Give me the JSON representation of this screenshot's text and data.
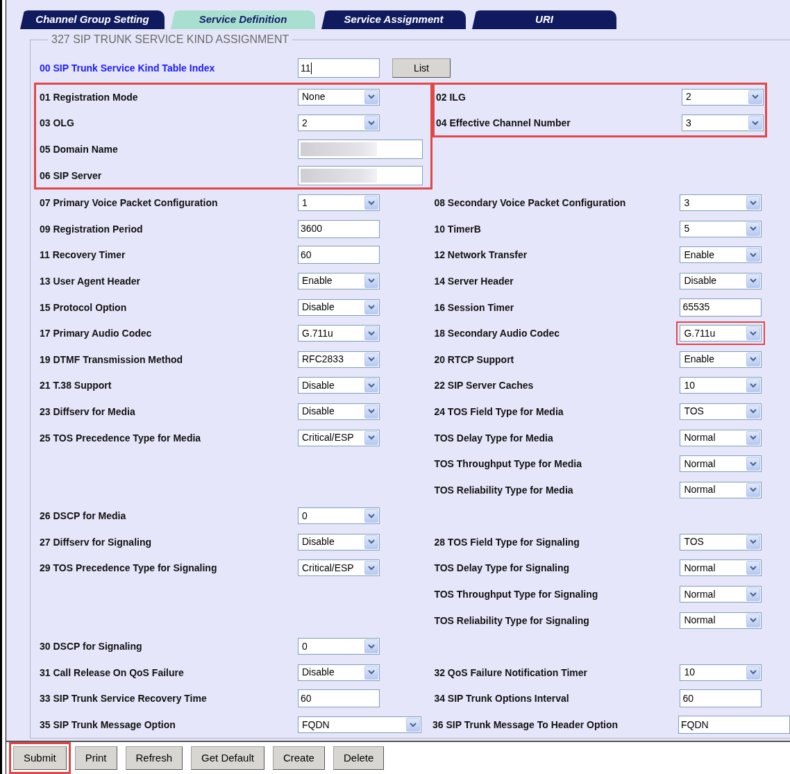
{
  "tabs": [
    {
      "label": "Channel Group Setting",
      "selected": false
    },
    {
      "label": "Service Definition",
      "selected": true
    },
    {
      "label": "Service Assignment",
      "selected": false
    },
    {
      "label": "URI",
      "selected": false
    }
  ],
  "legend": "327 SIP TRUNK SERVICE KIND ASSIGNMENT",
  "index_field": {
    "label": "00 SIP Trunk Service Kind Table Index",
    "value": "11",
    "focused": true,
    "button": "List"
  },
  "top_block": {
    "left": {
      "highlighted": true,
      "fields": [
        {
          "label": "01 Registration Mode",
          "kind": "select",
          "value": "None"
        },
        {
          "label": "03 OLG",
          "kind": "select",
          "value": "2"
        },
        {
          "label": "05 Domain Name",
          "kind": "blurred"
        },
        {
          "label": "06 SIP Server",
          "kind": "blurred"
        }
      ]
    },
    "right": {
      "highlighted": true,
      "fields": [
        {
          "label": "02 ILG",
          "kind": "select",
          "value": "2"
        },
        {
          "label": "04 Effective Channel Number",
          "kind": "select",
          "value": "3"
        }
      ]
    }
  },
  "rows": [
    {
      "left": {
        "label": "07 Primary Voice Packet Configuration",
        "kind": "select",
        "value": "1"
      },
      "right": {
        "label": "08 Secondary Voice Packet Configuration",
        "kind": "select",
        "value": "3"
      }
    },
    {
      "left": {
        "label": "09 Registration Period",
        "kind": "text",
        "value": "3600"
      },
      "right": {
        "label": "10 TimerB",
        "kind": "select",
        "value": "5"
      }
    },
    {
      "left": {
        "label": "11 Recovery Timer",
        "kind": "text",
        "value": "60"
      },
      "right": {
        "label": "12 Network Transfer",
        "kind": "select",
        "value": "Enable"
      }
    },
    {
      "left": {
        "label": "13 User Agent Header",
        "kind": "select",
        "value": "Enable"
      },
      "right": {
        "label": "14 Server Header",
        "kind": "select",
        "value": "Disable"
      }
    },
    {
      "left": {
        "label": "15 Protocol Option",
        "kind": "select",
        "value": "Disable"
      },
      "right": {
        "label": "16 Session Timer",
        "kind": "text",
        "value": "65535"
      }
    },
    {
      "left": {
        "label": "17 Primary Audio Codec",
        "kind": "select",
        "value": "G.711u"
      },
      "right": {
        "label": "18 Secondary Audio Codec",
        "kind": "select",
        "value": "G.711u",
        "highlighted": true
      }
    },
    {
      "left": {
        "label": "19 DTMF Transmission Method",
        "kind": "select",
        "value": "RFC2833"
      },
      "right": {
        "label": "20 RTCP Support",
        "kind": "select",
        "value": "Enable"
      }
    },
    {
      "left": {
        "label": "21 T.38 Support",
        "kind": "select",
        "value": "Disable"
      },
      "right": {
        "label": "22 SIP Server Caches",
        "kind": "select",
        "value": "10"
      }
    },
    {
      "left": {
        "label": "23 Diffserv for Media",
        "kind": "select",
        "value": "Disable"
      },
      "right": {
        "label": "24 TOS Field Type for Media",
        "kind": "select",
        "value": "TOS"
      }
    },
    {
      "left": {
        "label": "25 TOS Precedence Type for Media",
        "kind": "select",
        "value": "Critical/ESP"
      },
      "right": {
        "label": "TOS Delay Type for Media",
        "kind": "select",
        "value": "Normal"
      }
    },
    {
      "right": {
        "label": "TOS Throughput Type for Media",
        "kind": "select",
        "value": "Normal"
      }
    },
    {
      "right": {
        "label": "TOS Reliability Type for Media",
        "kind": "select",
        "value": "Normal"
      }
    },
    {
      "left": {
        "label": "26 DSCP for Media",
        "kind": "select",
        "value": "0"
      }
    },
    {
      "left": {
        "label": "27 Diffserv for Signaling",
        "kind": "select",
        "value": "Disable"
      },
      "right": {
        "label": "28 TOS Field Type for Signaling",
        "kind": "select",
        "value": "TOS"
      }
    },
    {
      "left": {
        "label": "29 TOS Precedence Type for Signaling",
        "kind": "select",
        "value": "Critical/ESP"
      },
      "right": {
        "label": "TOS Delay Type for Signaling",
        "kind": "select",
        "value": "Normal"
      }
    },
    {
      "right": {
        "label": "TOS Throughput Type for Signaling",
        "kind": "select",
        "value": "Normal"
      }
    },
    {
      "right": {
        "label": "TOS Reliability Type for Signaling",
        "kind": "select",
        "value": "Normal"
      }
    },
    {
      "left": {
        "label": "30 DSCP for Signaling",
        "kind": "select",
        "value": "0"
      }
    },
    {
      "left": {
        "label": "31 Call Release On QoS Failure",
        "kind": "select",
        "value": "Disable"
      },
      "right": {
        "label": "32 QoS Failure Notification Timer",
        "kind": "select",
        "value": "10"
      }
    },
    {
      "left": {
        "label": "33 SIP Trunk Service Recovery Time",
        "kind": "text",
        "value": "60"
      },
      "right": {
        "label": "34 SIP Trunk Options Interval",
        "kind": "text",
        "value": "60"
      }
    },
    {
      "left": {
        "label": "35 SIP Trunk Message Option",
        "kind": "select_wide",
        "value": "FQDN"
      },
      "right": {
        "label": "36 SIP Trunk Message To Header Option",
        "kind": "text_wide",
        "value": "FQDN"
      }
    }
  ],
  "buttons": [
    {
      "label": "Submit",
      "highlighted": true
    },
    {
      "label": "Print",
      "highlighted": false
    },
    {
      "label": "Refresh",
      "highlighted": false
    },
    {
      "label": "Get Default",
      "highlighted": false
    },
    {
      "label": "Create",
      "highlighted": false
    },
    {
      "label": "Delete",
      "highlighted": false
    }
  ]
}
